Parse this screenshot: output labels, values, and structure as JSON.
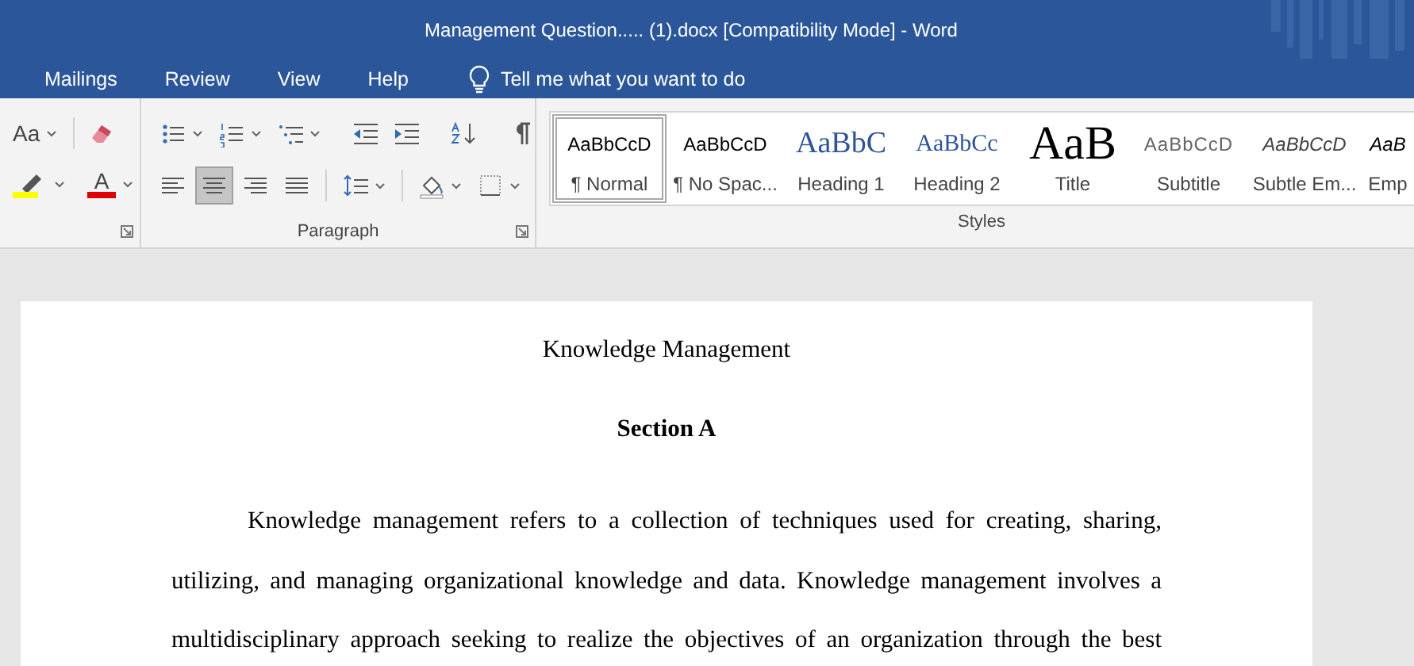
{
  "window": {
    "title": "Management Question..... (1).docx [Compatibility Mode]  -  Word"
  },
  "menu_tabs": [
    {
      "label": "Mailings",
      "selected": false
    },
    {
      "label": "Review",
      "selected": false
    },
    {
      "label": "View",
      "selected": false
    },
    {
      "label": "Help",
      "selected": false
    }
  ],
  "tell_me": {
    "placeholder": "Tell me what you want to do"
  },
  "font_group": {
    "change_case": "Aa",
    "font_color": "A"
  },
  "paragraph_group": {
    "label": "Paragraph",
    "row_1": [
      {
        "kind": "bullets",
        "dropdown": true
      },
      {
        "kind": "numbering",
        "dropdown": true
      },
      {
        "kind": "multilevel",
        "dropdown": true
      },
      {
        "kind": "separator"
      },
      {
        "kind": "outdent",
        "dropdown": false
      },
      {
        "kind": "indent",
        "dropdown": false
      },
      {
        "kind": "separator"
      },
      {
        "kind": "sort",
        "dropdown": false
      },
      {
        "kind": "separator"
      },
      {
        "kind": "pilcrow",
        "dropdown": false
      }
    ],
    "row_2": [
      {
        "kind": "align-left",
        "dropdown": false,
        "selected": false
      },
      {
        "kind": "align-center",
        "dropdown": false,
        "selected": true
      },
      {
        "kind": "align-right",
        "dropdown": false,
        "selected": false
      },
      {
        "kind": "justify",
        "dropdown": false,
        "selected": false
      },
      {
        "kind": "separator"
      },
      {
        "kind": "line-spacing",
        "dropdown": true,
        "selected": false
      },
      {
        "kind": "separator"
      },
      {
        "kind": "shading",
        "dropdown": true,
        "selected": false
      },
      {
        "kind": "borders",
        "dropdown": true,
        "selected": false
      }
    ]
  },
  "styles_group": {
    "label": "Styles",
    "items": [
      {
        "preview": "AaBbCcD",
        "label": "¶ Normal",
        "kind": "normal",
        "selected": true
      },
      {
        "preview": "AaBbCcD",
        "label": "¶ No Spac...",
        "kind": "normal",
        "selected": false
      },
      {
        "preview": "AaBbC",
        "label": "Heading 1",
        "kind": "heading1",
        "selected": false
      },
      {
        "preview": "AaBbCc",
        "label": "Heading 2",
        "kind": "heading2",
        "selected": false
      },
      {
        "preview": "AaB",
        "label": "Title",
        "kind": "title",
        "selected": false
      },
      {
        "preview": "AaBbCcD",
        "label": "Subtitle",
        "kind": "subtitle",
        "selected": false
      },
      {
        "preview": "AaBbCcD",
        "label": "Subtle Em...",
        "kind": "subtle",
        "selected": false
      },
      {
        "preview": "AaB",
        "label": "Emp",
        "kind": "emphasis",
        "selected": false
      }
    ]
  },
  "document": {
    "title": "Knowledge Management",
    "heading": "Section A",
    "paragraph_lines": [
      "Knowledge management refers to a collection of techniques used for creating, sharing,",
      "utilizing, and managing organizational knowledge and data.  Knowledge management involves a",
      "multidisciplinary approach seeking to realize the objectives of an organization through the best"
    ]
  }
}
